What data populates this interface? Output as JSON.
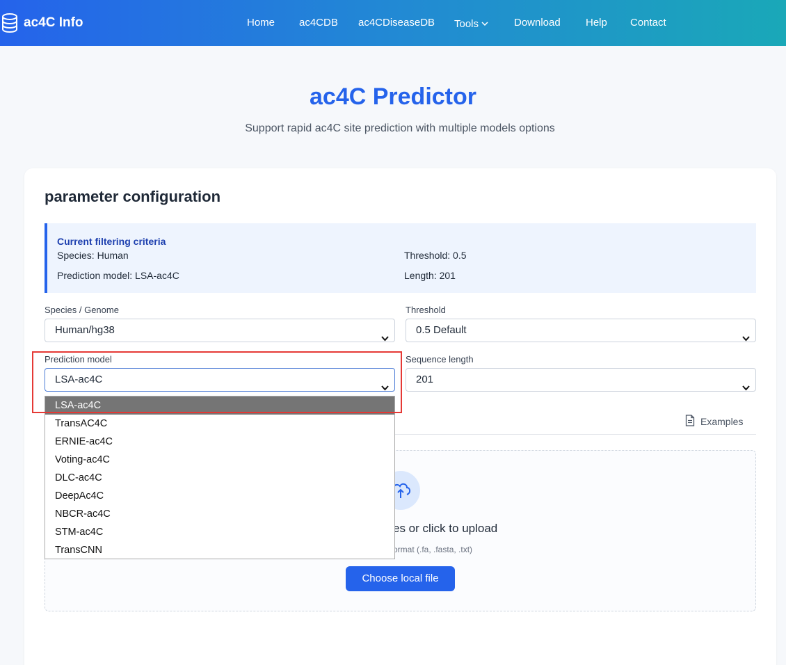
{
  "header": {
    "brand": "ac4C Info",
    "nav": [
      "Home",
      "ac4CDB",
      "ac4CDiseaseDB",
      "Tools",
      "Download",
      "Help",
      "Contact"
    ]
  },
  "hero": {
    "title": "ac4C Predictor",
    "subtitle": "Support rapid ac4C site prediction with multiple models options"
  },
  "card": {
    "title": "parameter configuration",
    "criteria": {
      "heading": "Current filtering criteria",
      "species": "Species: Human",
      "threshold": "Threshold: 0.5",
      "model": "Prediction model: LSA-ac4C",
      "length": "Length: 201"
    },
    "fields": {
      "species_label": "Species / Genome",
      "species_value": "Human/hg38",
      "threshold_label": "Threshold",
      "threshold_value": "0.5 Default",
      "model_label": "Prediction model",
      "model_value": "LSA-ac4C",
      "length_label": "Sequence length",
      "length_value": "201"
    },
    "model_options": [
      "LSA-ac4C",
      "TransAC4C",
      "ERNIE-ac4C",
      "Voting-ac4C",
      "DLC-ac4C",
      "DeepAc4C",
      "NBCR-ac4C",
      "STM-ac4C",
      "TransCNN"
    ],
    "examples": "Examples",
    "upload": {
      "text": "es or click to upload",
      "hint": "ormat (.fa, .fasta, .txt)",
      "button": "Choose local file"
    }
  },
  "colors": {
    "accent": "#2563eb",
    "highlight": "#e53935",
    "selected_option": "#757575"
  }
}
